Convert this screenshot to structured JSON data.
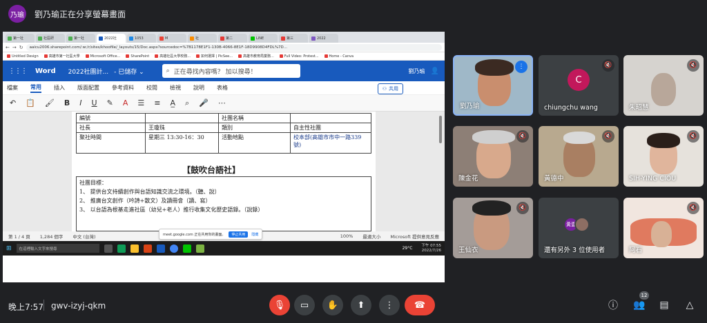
{
  "presenter": {
    "avatar": "乃瑜",
    "banner": "劉乃瑜正在分享螢幕畫面"
  },
  "browser": {
    "tabs": [
      {
        "label": "第一社",
        "color": "#4caf50"
      },
      {
        "label": "社區研",
        "color": "#4caf50"
      },
      {
        "label": "第一社",
        "color": "#4caf50"
      },
      {
        "label": "2022社",
        "color": "#185abd"
      },
      {
        "label": "1053",
        "color": "#1e88e5"
      },
      {
        "label": "M",
        "color": "#ea4335"
      },
      {
        "label": "社",
        "color": "#fb8c00"
      },
      {
        "label": "第二",
        "color": "#e53935"
      },
      {
        "label": "LINE",
        "color": "#00c300"
      },
      {
        "label": "第三",
        "color": "#e53935"
      },
      {
        "label": "2022",
        "color": "#7e57c2"
      }
    ],
    "url": "aaicu2006.sharepoint.com/:w:/r/sites/khoofile/_layouts/15/Doc.aspx?sourcedoc=%7B1178E1F1-130B-4066-8E1F-18D9908D4FDL%7D...",
    "bookmarks": [
      "Untitled Design",
      "高雄市第一社區大學",
      "Microsoft Office...",
      "SharePoint",
      "高雄社區大學校務...",
      "如何選擇 | PicSee...",
      "高雄市教育局業務...",
      "Full Video: Protest...",
      "Home - Canva"
    ]
  },
  "word": {
    "app_name": "Word",
    "doc_title": "2022社團計...",
    "save_state": "- 已儲存 ⌄",
    "search_placeholder": "正在尋找內容嗎？ 加以搜尋！",
    "user": "劉乃瑜",
    "ribbon_tabs": [
      "檔案",
      "常用",
      "插入",
      "版面配置",
      "參考資料",
      "校閱",
      "檢視",
      "說明",
      "表格"
    ],
    "active_tab": "常用",
    "share_label": "共用",
    "table": {
      "r1": [
        "編號",
        "",
        "社團名稱",
        ""
      ],
      "r2": [
        "社長",
        "王瓊珠",
        "類別",
        "自主性社團"
      ],
      "r3": [
        "聚社時間",
        "星期三 13:30-16：30",
        "活動地點",
        "校本部(高雄市市中一路339號)"
      ]
    },
    "club_title": "【鼓吹台語社】",
    "goals_heading": "社團目標：",
    "goals": [
      "1、 提供台文持續創作與台語知識交流之環境。（聽、說）",
      "2、 推廣台文創作（吟詩+散文）及讀冊會（讀、寫）",
      "3、 以台語為根基走進社區（幼兒+老人）推行收集文化歷史語錄。（說錄）"
    ],
    "status": {
      "page": "第 1 / 4 頁",
      "words": "1,284 個字",
      "lang": "中文 (台灣)",
      "zoom": "100%",
      "fit": "最適大小",
      "feedback": "Microsoft 提供意見反應"
    },
    "sharing_pill": {
      "text": "meet.google.com 正在共用你的畫面。",
      "stop": "停止共用",
      "hide": "隱藏"
    }
  },
  "taskbar": {
    "search": "在這裡輸入文字來搜尋",
    "temp": "29°C",
    "time": "下午 07:55",
    "date": "2022/7/26"
  },
  "participants": [
    {
      "name": "劉乃瑜",
      "mic": "on"
    },
    {
      "name": "chiungchu wang",
      "mic": "off",
      "initial": "C"
    },
    {
      "name": "朱昭慧",
      "mic": "off"
    },
    {
      "name": "陳金花",
      "mic": "off"
    },
    {
      "name": "黃德中",
      "mic": "off"
    },
    {
      "name": "SIH-YING CIOU",
      "mic": "off"
    },
    {
      "name": "王仙衣",
      "mic": "off"
    },
    {
      "name": "還有另外 3 位使用者",
      "mic": "none",
      "initials": [
        "黃壹",
        ""
      ]
    },
    {
      "name": "阿石",
      "mic": "off"
    }
  ],
  "meeting": {
    "time": "晚上7:57",
    "code": "gwv-izyj-qkm",
    "participant_count": "12"
  }
}
